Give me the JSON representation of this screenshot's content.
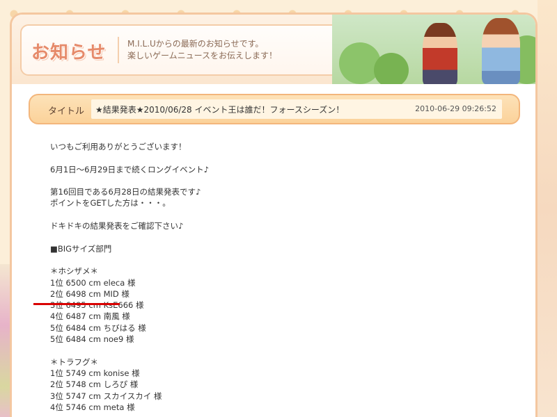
{
  "header": {
    "logo": "お知らせ",
    "desc_line1": "M.I.L.Uからの最新のお知らせです。",
    "desc_line2": "楽しいゲームニュースをお伝えします！"
  },
  "article": {
    "title_label": "タイトル",
    "title": "★結果発表★2010/06/28 イベント王は誰だ！フォースシーズン！",
    "date": "2010-06-29 09:26:52",
    "paragraphs": [
      [
        "いつもご利用ありがとうございます！"
      ],
      [
        "6月1日〜6月29日まで続くロングイベント♪"
      ],
      [
        "第16回目である6月28日の結果発表です♪",
        "ポイントをGETした方は・・・。"
      ],
      [
        "ドキドキの結果発表をご確認下さい♪"
      ],
      [
        "■BIGサイズ部門"
      ],
      [
        "＊ホシザメ＊",
        "1位 6500 cm eleca 様",
        "2位 6498 cm MID 様",
        "3位 6495 cm KsE666 様",
        "4位 6487 cm 南風 様",
        "5位 6484 cm ちびはる 様",
        "5位 6484 cm noe9 様"
      ],
      [
        "＊トラフグ＊",
        "1位 5749 cm konise 様",
        "2位 5748 cm しろぴ 様",
        "3位 5747 cm スカイスカイ 様",
        "4位 5746 cm meta 様"
      ]
    ]
  },
  "colors": {
    "accent": "#e68a6a",
    "title_bar": "#fbd29a",
    "highlight": "#d90000"
  }
}
